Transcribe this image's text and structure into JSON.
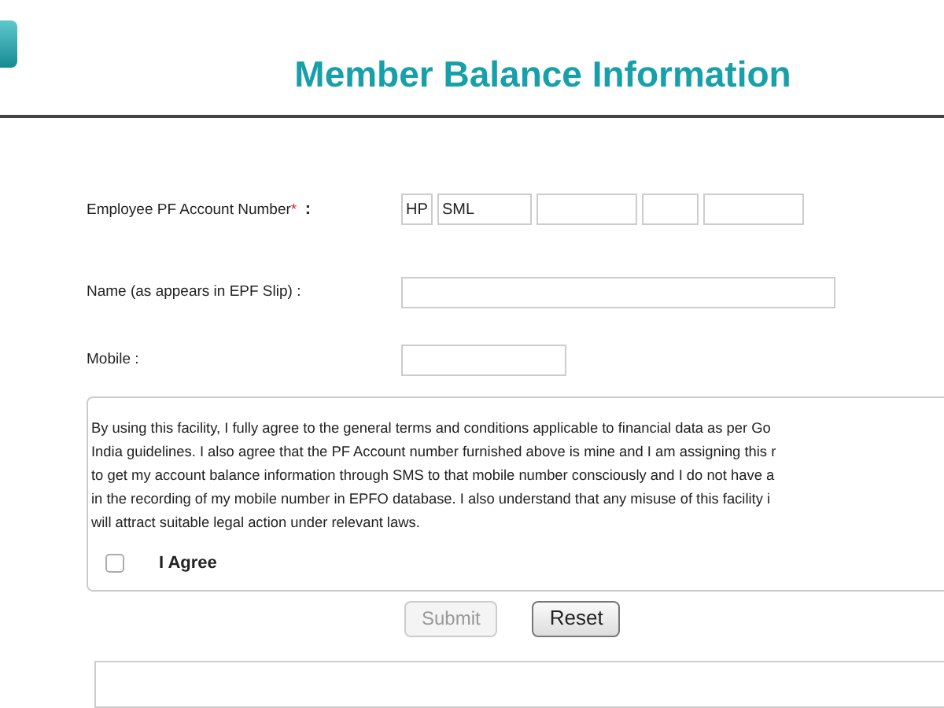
{
  "header": {
    "title": "Member Balance Information"
  },
  "form": {
    "pf_account": {
      "label": "Employee PF Account Number",
      "required_mark": "*",
      "separator": ":",
      "fields": [
        {
          "kind": "prefilled",
          "value": "HP"
        },
        {
          "kind": "prefilled",
          "value": "SML"
        },
        {
          "kind": "blank"
        },
        {
          "kind": "blank"
        },
        {
          "kind": "blank"
        }
      ]
    },
    "name": {
      "label": "Name (as appears in EPF Slip) :"
    },
    "mobile": {
      "label": "Mobile :"
    }
  },
  "terms": {
    "lines": [
      "By using this facility, I fully agree to the general terms and conditions applicable to financial data as per Go",
      "India guidelines. I also agree that the PF Account number furnished above is mine and I am assigning this r",
      "to get my account balance information through SMS to that mobile number consciously and I do not have a",
      "in the recording of my mobile number in EPFO database. I also understand that any misuse of this facility i",
      "will attract suitable legal action under relevant laws."
    ],
    "agree": {
      "label": "I Agree",
      "checked": false
    }
  },
  "buttons": [
    {
      "label": "Submit",
      "disabled": true
    },
    {
      "label": "Reset",
      "disabled": false
    }
  ]
}
